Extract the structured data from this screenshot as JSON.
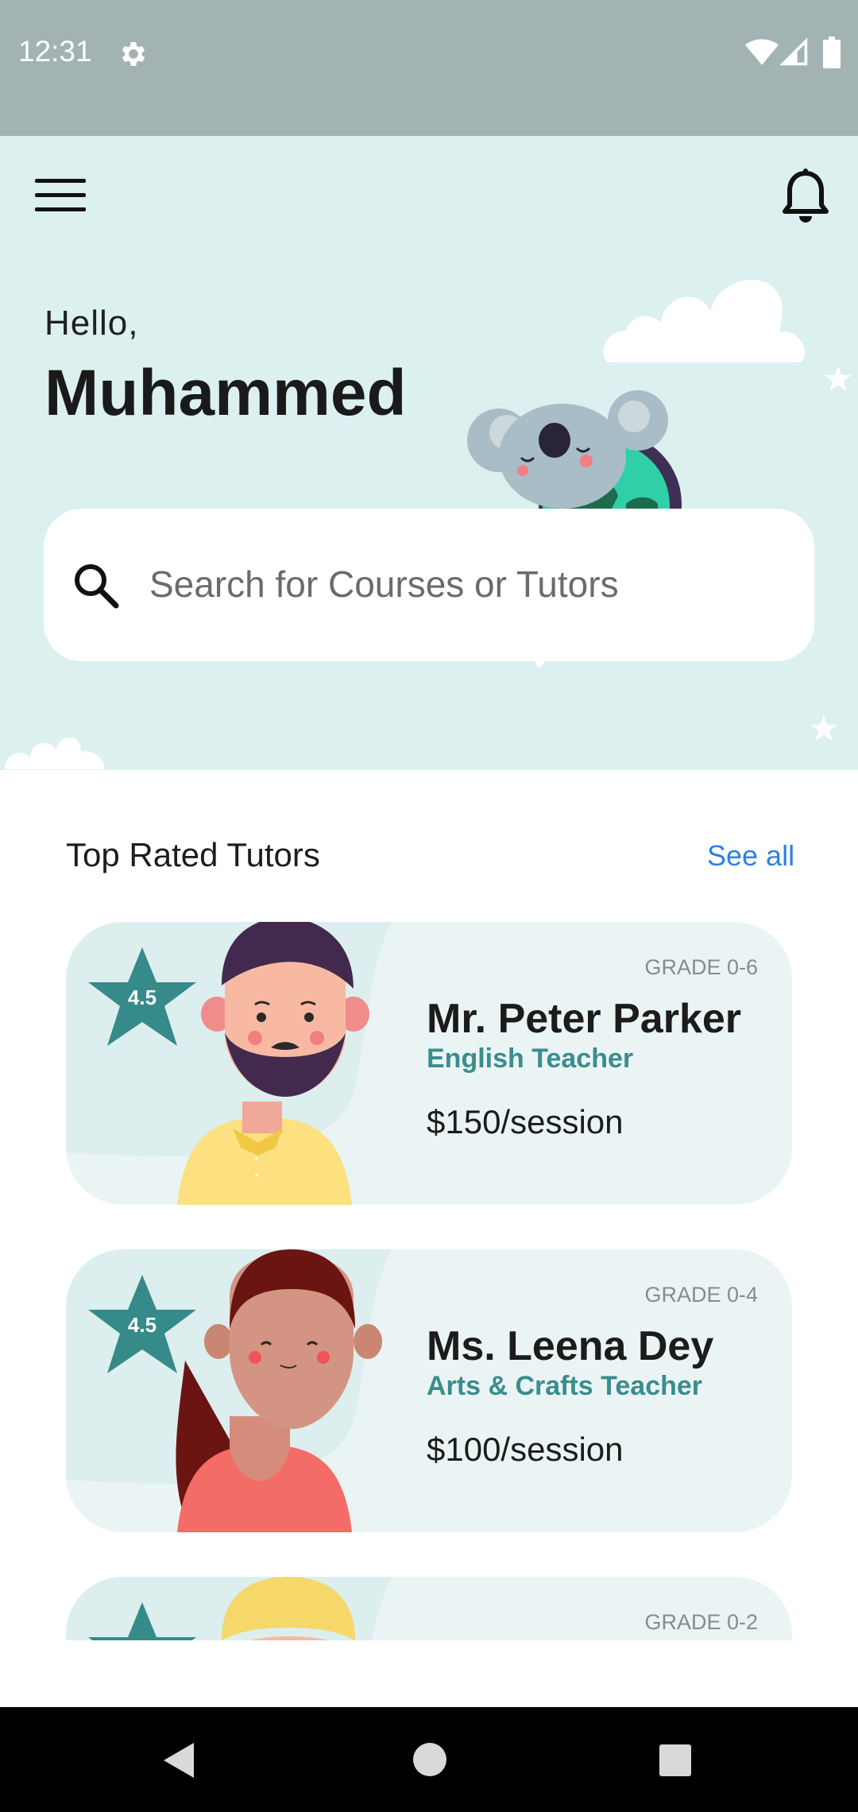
{
  "status_bar": {
    "time": "12:31"
  },
  "header": {
    "greeting": "Hello,",
    "user_name": "Muhammed"
  },
  "search": {
    "placeholder": "Search for Courses or Tutors",
    "value": ""
  },
  "section": {
    "title": "Top Rated Tutors",
    "see_all": "See all"
  },
  "tutors": [
    {
      "grade": "GRADE 0-6",
      "name": "Mr. Peter Parker",
      "subject": "English Teacher",
      "price": "$150/session",
      "rating": "4.5"
    },
    {
      "grade": "GRADE 0-4",
      "name": "Ms. Leena Dey",
      "subject": "Arts & Crafts Teacher",
      "price": "$100/session",
      "rating": "4.5"
    },
    {
      "grade": "GRADE 0-2"
    }
  ],
  "colors": {
    "accent": "#3a8d8d",
    "hero_bg": "#dcf0f0",
    "link": "#2f80e6",
    "card_bg": "#ebf4f4"
  }
}
